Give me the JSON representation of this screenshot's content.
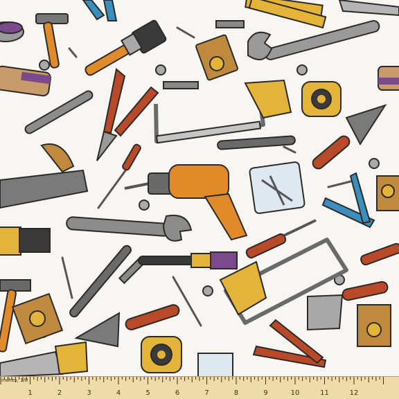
{
  "image": {
    "subject": "fabric",
    "motif_items": [
      {
        "name": "paint-can"
      },
      {
        "name": "claw-hammer"
      },
      {
        "name": "pliers"
      },
      {
        "name": "paint-brush"
      },
      {
        "name": "screws"
      },
      {
        "name": "folding-ruler"
      },
      {
        "name": "adjustable-wrench"
      },
      {
        "name": "paint-roller"
      },
      {
        "name": "wood-plane"
      },
      {
        "name": "hacksaw"
      },
      {
        "name": "tape-measure"
      },
      {
        "name": "trowel"
      },
      {
        "name": "screwdriver"
      },
      {
        "name": "power-drill"
      },
      {
        "name": "nail-bag"
      },
      {
        "name": "open-end-wrench"
      },
      {
        "name": "hand-saw"
      },
      {
        "name": "putty-knife"
      },
      {
        "name": "nails"
      },
      {
        "name": "nuts"
      }
    ],
    "colors": {
      "background": "#f7f6f2",
      "orange": "#e08a2a",
      "red_handle": "#b84a2a",
      "metal": "#8c8c8c",
      "wood": "#c08a3e",
      "yellow": "#e3b33a",
      "purple": "#7a4a8c",
      "outline": "#2d2a26"
    }
  },
  "ruler": {
    "unit_label": "inches, 1/8",
    "numbers": [
      "1",
      "2",
      "3",
      "4",
      "5",
      "6",
      "7",
      "8",
      "9",
      "10",
      "11",
      "12"
    ]
  }
}
